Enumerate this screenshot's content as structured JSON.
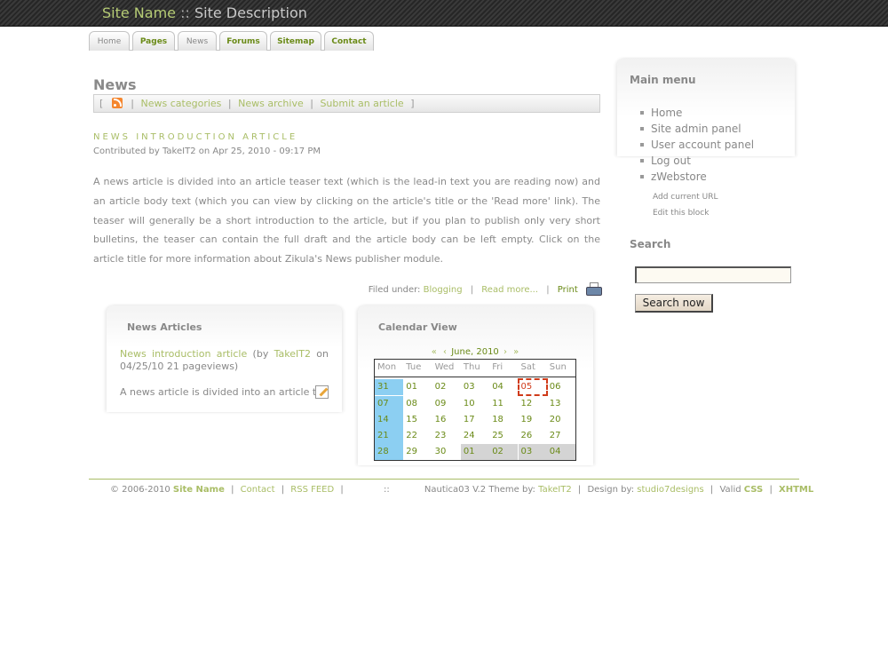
{
  "header": {
    "site_name": "Site Name",
    "separator": " :: ",
    "site_description": "Site Description"
  },
  "tabs": [
    {
      "label": "Home"
    },
    {
      "label": "Pages"
    },
    {
      "label": "News"
    },
    {
      "label": "Forums"
    },
    {
      "label": "Sitemap"
    },
    {
      "label": "Contact"
    }
  ],
  "main": {
    "title": "News",
    "subnav": {
      "open_bracket": "[",
      "close_bracket": "]",
      "pipe": "|",
      "rss_icon": "rss-icon",
      "links": [
        "News categories",
        "News archive",
        "Submit an article"
      ]
    },
    "article": {
      "title": "NEWS INTRODUCTION ARTICLE",
      "meta": "Contributed by TakeIT2 on Apr 25, 2010 - 09:17 PM",
      "body": "A news article is divided into an article teaser text (which is the lead-in text you are reading now) and an article body text (which you can view by clicking on the article's title or the 'Read more' link). The teaser will generally be a short introduction to the article, but if you plan to publish only very short bulletins, the teaser can contain the full draft and the article body can be left empty. Click on the article title for more information about Zikula's News publisher module.",
      "filed_under_label": "Filed under:",
      "category": "Blogging",
      "read_more": "Read more...",
      "print": "Print",
      "pipe": "|",
      "printer_icon": "printer-icon"
    }
  },
  "news_box": {
    "title": "News Articles",
    "link": "News introduction article",
    "by_prefix": "(by",
    "author": "TakeIT2",
    "on_text": "on 04/25/10 21 pageviews)",
    "teaser": "A news article is divided into an article teaser text",
    "edit_icon": "edit-icon"
  },
  "calendar": {
    "title": "Calendar View",
    "prev_year": "«",
    "prev_month": "‹",
    "month_label": "June, 2010",
    "next_month": "›",
    "next_year": "»",
    "weekdays": [
      "Mon",
      "Tue",
      "Wed",
      "Thu",
      "Fri",
      "Sat",
      "Sun"
    ],
    "weeks": [
      [
        "31",
        "01",
        "02",
        "03",
        "04",
        "05",
        "06"
      ],
      [
        "07",
        "08",
        "09",
        "10",
        "11",
        "12",
        "13"
      ],
      [
        "14",
        "15",
        "16",
        "17",
        "18",
        "19",
        "20"
      ],
      [
        "21",
        "22",
        "23",
        "24",
        "25",
        "26",
        "27"
      ],
      [
        "28",
        "29",
        "30",
        "01",
        "02",
        "03",
        "04"
      ]
    ],
    "highlight_color": "#8ccff2",
    "today_border_color": "#d03b1a"
  },
  "sidebar": {
    "main_menu_title": "Main menu",
    "menu_items": [
      "Home",
      "Site admin panel",
      "User account panel",
      "Log out",
      "zWebstore"
    ],
    "add_current_url": "Add current URL",
    "edit_block": "Edit this block",
    "search_title": "Search",
    "search_value": "",
    "search_button": "Search now"
  },
  "footer": {
    "copyright": "© 2006-2010",
    "site_name": "Site Name",
    "contact": "Contact",
    "rss": "RSS FEED",
    "double_colon": "::",
    "theme_text": "Nautica03 V.2 Theme by:",
    "theme_author": "TakeIT2",
    "design_text": "Design by:",
    "designer": "studio7designs",
    "valid_text": "Valid",
    "css": "CSS",
    "xhtml": "XHTML",
    "pipe": "|"
  },
  "colors": {
    "accent_green": "#a9bd66",
    "dark_green": "#6a8a17",
    "header_dark": "#2a2a2a"
  }
}
